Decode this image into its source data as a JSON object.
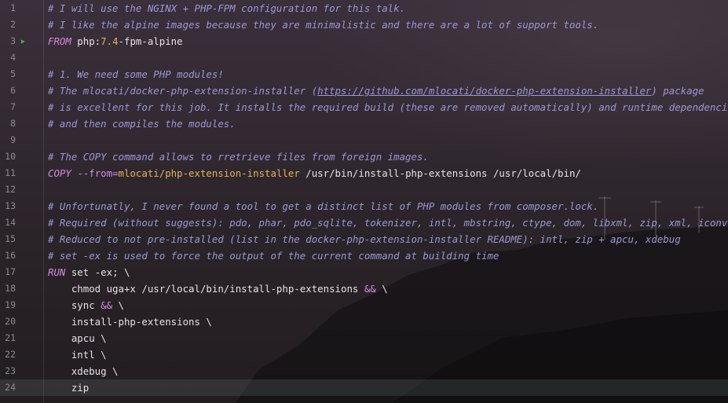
{
  "editor": {
    "gutter_marker_line": 3,
    "current_line": 24,
    "lines": [
      {
        "n": "1",
        "tokens": [
          {
            "t": "c",
            "v": "# I will use the NGINX + PHP-FPM configuration for this talk."
          }
        ]
      },
      {
        "n": "2",
        "tokens": [
          {
            "t": "c",
            "v": "# I like the alpine images because they are minimalistic and there are a lot of support tools."
          }
        ]
      },
      {
        "n": "3",
        "tokens": [
          {
            "t": "kw",
            "v": "FROM"
          },
          {
            "t": "pl",
            "v": " php:"
          },
          {
            "t": "str",
            "v": "7.4"
          },
          {
            "t": "pl",
            "v": "-fpm-alpine"
          }
        ]
      },
      {
        "n": "4",
        "tokens": []
      },
      {
        "n": "5",
        "tokens": [
          {
            "t": "c",
            "v": "# 1. We need some PHP modules!"
          }
        ]
      },
      {
        "n": "6",
        "tokens": [
          {
            "t": "c",
            "v": "# The mlocati/docker-php-extension-installer ("
          },
          {
            "t": "c-link",
            "v": "https://github.com/mlocati/docker-php-extension-installer"
          },
          {
            "t": "c",
            "v": ") package"
          }
        ]
      },
      {
        "n": "7",
        "tokens": [
          {
            "t": "c",
            "v": "# is excellent for this job. It installs the required build (these are removed automatically) and runtime dependencies"
          }
        ]
      },
      {
        "n": "8",
        "tokens": [
          {
            "t": "c",
            "v": "# and then compiles the modules."
          }
        ]
      },
      {
        "n": "9",
        "tokens": []
      },
      {
        "n": "10",
        "tokens": [
          {
            "t": "c",
            "v": "# The COPY command allows to rretrieve files from foreign images."
          }
        ]
      },
      {
        "n": "11",
        "tokens": [
          {
            "t": "kw",
            "v": "COPY"
          },
          {
            "t": "pl",
            "v": " "
          },
          {
            "t": "op",
            "v": "--from="
          },
          {
            "t": "str",
            "v": "mlocati/php-extension-installer"
          },
          {
            "t": "pl",
            "v": " /usr/bin/install-php-extensions /usr/local/bin/"
          }
        ]
      },
      {
        "n": "12",
        "tokens": []
      },
      {
        "n": "13",
        "tokens": [
          {
            "t": "c",
            "v": "# Unfortunatly, I never found a tool to get a distinct list of PHP modules from composer.lock."
          }
        ]
      },
      {
        "n": "14",
        "tokens": [
          {
            "t": "c",
            "v": "# Required (without suggests): pdo, phar, pdo_sqlite, tokenizer, intl, mbstring, ctype, dom, libxml, zip, xml, iconv, json"
          }
        ]
      },
      {
        "n": "15",
        "tokens": [
          {
            "t": "c",
            "v": "# Reduced to not pre-installed (list in the docker-php-extension-installer README): intl, zip + apcu, xdebug"
          }
        ]
      },
      {
        "n": "16",
        "tokens": [
          {
            "t": "c",
            "v": "# set -ex is used to force the output of the current command at building time"
          }
        ]
      },
      {
        "n": "17",
        "tokens": [
          {
            "t": "kw",
            "v": "RUN"
          },
          {
            "t": "pl",
            "v": " set -ex; \\"
          }
        ]
      },
      {
        "n": "18",
        "tokens": [
          {
            "t": "pl",
            "v": "    chmod uga+x /usr/local/bin/install-php-extensions "
          },
          {
            "t": "op",
            "v": "&&"
          },
          {
            "t": "pl",
            "v": " \\"
          }
        ]
      },
      {
        "n": "19",
        "tokens": [
          {
            "t": "pl",
            "v": "    sync "
          },
          {
            "t": "op",
            "v": "&&"
          },
          {
            "t": "pl",
            "v": " \\"
          }
        ]
      },
      {
        "n": "20",
        "tokens": [
          {
            "t": "pl",
            "v": "    install-php-extensions \\"
          }
        ]
      },
      {
        "n": "21",
        "tokens": [
          {
            "t": "pl",
            "v": "    apcu \\"
          }
        ]
      },
      {
        "n": "22",
        "tokens": [
          {
            "t": "pl",
            "v": "    intl \\"
          }
        ]
      },
      {
        "n": "23",
        "tokens": [
          {
            "t": "pl",
            "v": "    xdebug \\"
          }
        ]
      },
      {
        "n": "24",
        "tokens": [
          {
            "t": "pl",
            "v": "    zip"
          }
        ]
      }
    ]
  }
}
